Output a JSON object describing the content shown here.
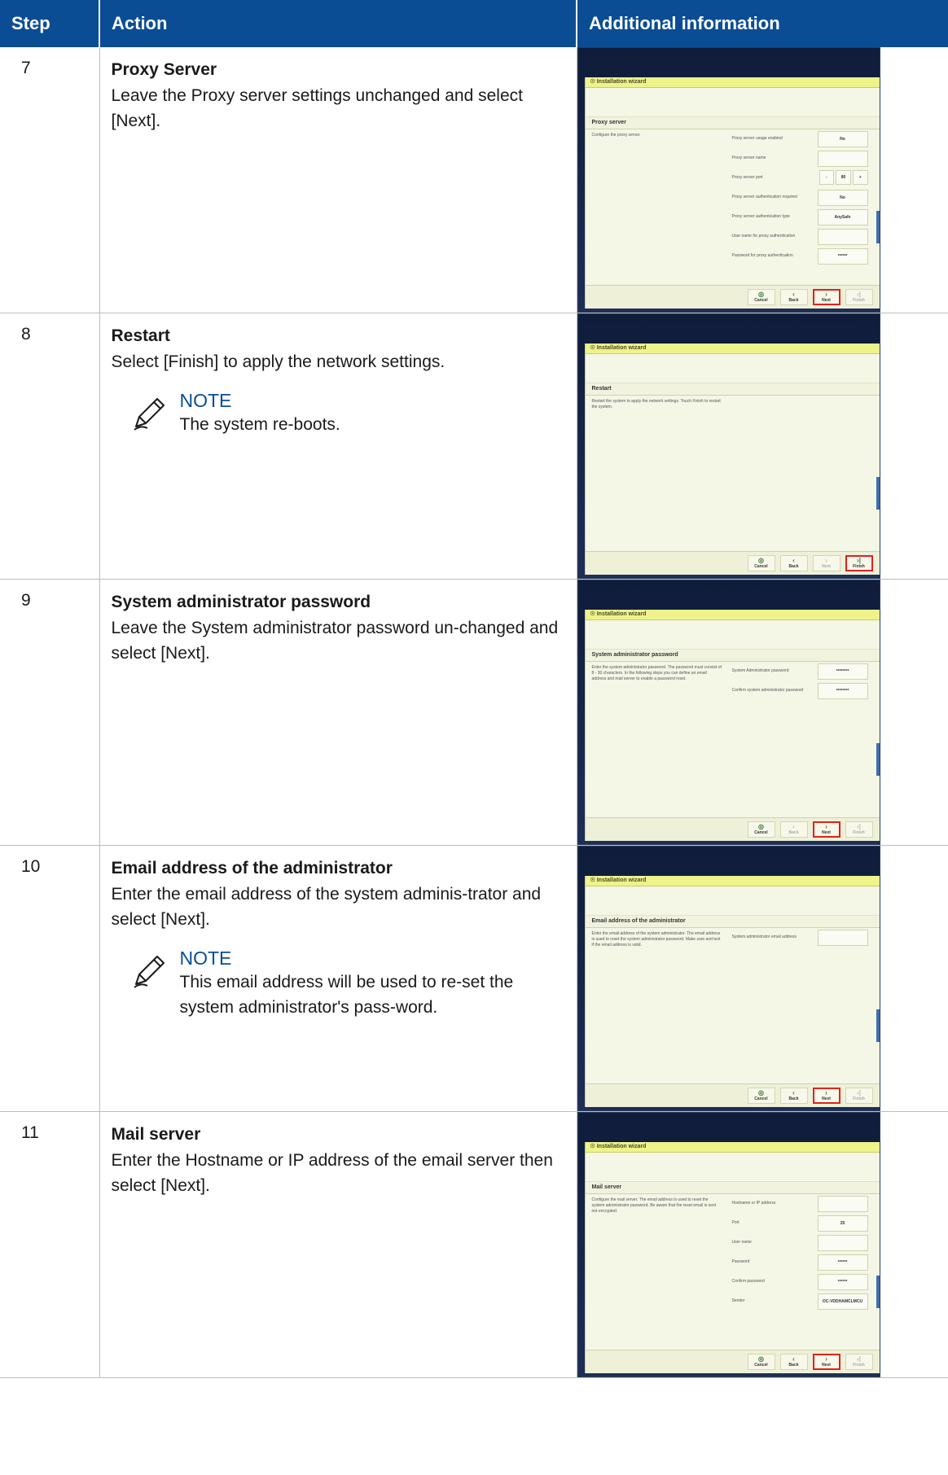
{
  "headers": {
    "step": "Step",
    "action": "Action",
    "info": "Additional information"
  },
  "wizard_title": "Installation wizard",
  "buttons": {
    "cancel": "Cancel",
    "back": "Back",
    "next": "Next",
    "finish": "Finish"
  },
  "rows": [
    {
      "step": "7",
      "title": "Proxy Server",
      "body": "Leave the Proxy server settings unchanged and select [Next].",
      "shot": {
        "section": "Proxy server",
        "text": "Configure the proxy server.",
        "fields": [
          {
            "label": "Proxy server usage enabled",
            "value": "No"
          },
          {
            "label": "Proxy server name",
            "value": ""
          },
          {
            "label": "Proxy server port",
            "value": "80"
          },
          {
            "label": "Proxy server authentication required",
            "value": "No"
          },
          {
            "label": "Proxy server authentication type",
            "value": "AnySafe"
          },
          {
            "label": "User name for proxy authentication",
            "value": ""
          },
          {
            "label": "Password for proxy authentication",
            "value": "******"
          }
        ],
        "highlight": "next"
      }
    },
    {
      "step": "8",
      "title": "Restart",
      "body": "Select [Finish] to apply the network settings.",
      "note_label": "NOTE",
      "note_text": "The system re-boots.",
      "shot": {
        "section": "Restart",
        "text": "Restart the system to apply the network settings. Touch Finish to restart the system.",
        "highlight": "finish"
      }
    },
    {
      "step": "9",
      "title": "System administrator password",
      "body": "Leave the System administrator password un-changed and select [Next].",
      "shot": {
        "section": "System administrator password",
        "text": "Enter the system administrator password. The password must consist of 8 - 30 characters. In the following steps you can define an email address and mail server to enable a password reset.",
        "fields": [
          {
            "label": "System Administrator password",
            "value": "********"
          },
          {
            "label": "Confirm system administrator password",
            "value": "********"
          }
        ],
        "highlight": "next"
      }
    },
    {
      "step": "10",
      "title": "Email address of the administrator",
      "body": "Enter the email address of the system adminis-trator and select [Next].",
      "note_label": "NOTE",
      "note_text": "This email address will be used to re-set the system administrator's pass-word.",
      "shot": {
        "section": "Email address of the administrator",
        "text": "Enter the email address of the system administrator. The email address is used to reset the system administrator password. Make sure and test if the email address is valid.",
        "fields": [
          {
            "label": "System administrator email address",
            "value": ""
          }
        ],
        "highlight": "next"
      }
    },
    {
      "step": "11",
      "title": "Mail server",
      "body": "Enter the Hostname or IP address of the email server then select [Next].",
      "shot": {
        "section": "Mail server",
        "text": "Configure the mail server. The email address is used to reset the system administrator password. Be aware that the reset email is sent not encrypted.",
        "fields": [
          {
            "label": "Hostname or IP address",
            "value": ""
          },
          {
            "label": "Port",
            "value": "25"
          },
          {
            "label": "User name",
            "value": ""
          },
          {
            "label": "Password",
            "value": "******"
          },
          {
            "label": "Confirm password",
            "value": "******"
          },
          {
            "label": "Sender",
            "value": "OC-VDDHAMCLMCU"
          }
        ],
        "highlight": "next"
      }
    }
  ]
}
